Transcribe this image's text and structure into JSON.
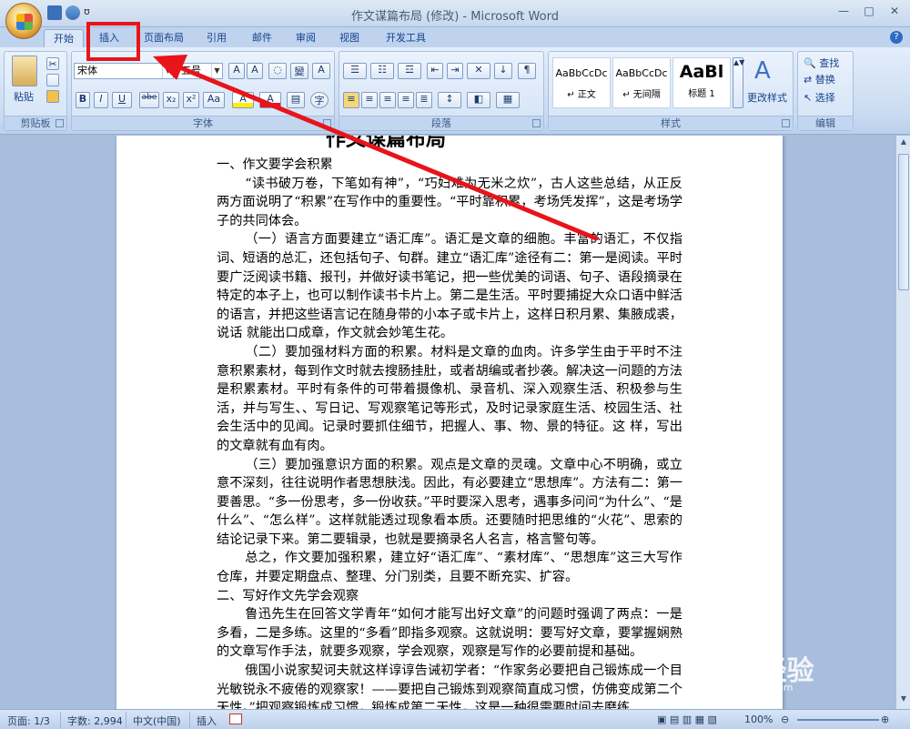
{
  "window": {
    "title": "作文谋篇布局 (修改) - Microsoft Word",
    "redo_glyph": "ʊ",
    "controls": [
      "—",
      "□",
      "✕"
    ]
  },
  "tabs": [
    {
      "label": "开始",
      "active": true
    },
    {
      "label": "插入",
      "active": false
    },
    {
      "label": "页面布局",
      "active": false
    },
    {
      "label": "引用",
      "active": false
    },
    {
      "label": "邮件",
      "active": false
    },
    {
      "label": "审阅",
      "active": false
    },
    {
      "label": "视图",
      "active": false
    },
    {
      "label": "开发工具",
      "active": false
    }
  ],
  "ribbon": {
    "clipboard": {
      "label": "剪贴板",
      "paste": "粘贴"
    },
    "font": {
      "label": "字体",
      "font_name": "宋体",
      "font_size": "五号",
      "buttons": [
        "B",
        "I",
        "U",
        "abe",
        "x₂",
        "x²",
        "Aa",
        "A",
        "A"
      ]
    },
    "paragraph": {
      "label": "段落"
    },
    "styles": {
      "label": "样式",
      "items": [
        {
          "sample": "AaBbCcDc",
          "name": "↵ 正文"
        },
        {
          "sample": "AaBbCcDc",
          "name": "↵ 无间隔"
        },
        {
          "sample": "AaBl",
          "name": "标题 1"
        }
      ],
      "change_styles": "更改样式"
    },
    "editing": {
      "label": "编辑",
      "find": "查找",
      "replace": "替换",
      "select": "选择"
    }
  },
  "document": {
    "title": "作文谋篇布局",
    "paragraphs": [
      {
        "text": "一、作文要学会积累",
        "indent": false
      },
      {
        "text": "“读书破万卷，下笔如有神”，“巧妇难为无米之炊”，古人这些总结，从正反两方面说明了“积累”在写作中的重要性。“平时靠积累，考场凭发挥”，这是考场学子的共同体会。",
        "indent": true
      },
      {
        "text": "（一）语言方面要建立“语汇库”。语汇是文章的细胞。丰富的语汇，不仅指词、短语的总汇，还包括句子、句群。建立“语汇库”途径有二：第一是阅读。平时要广泛阅读书籍、报刊，并做好读书笔记，把一些优美的词语、句子、语段摘录在特定的本子上，也可以制作读书卡片上。第二是生活。平时要捕捉大众口语中鲜活的语言，并把这些语言记在随身带的小本子或卡片上，这样日积月累、集腋成裘，说话 就能出口成章，作文就会妙笔生花。",
        "indent": true
      },
      {
        "text": "（二）要加强材料方面的积累。材料是文章的血肉。许多学生由于平时不注意积累素材，每到作文时就去搜肠挂肚，或者胡编或者抄袭。解决这一问题的方法是积累素材。平时有条件的可带着摄像机、录音机、深入观察生活、积极参与生活，并与写生、、写日记、写观察笔记等形式，及时记录家庭生活、校园生活、社会生活中的见闻。记录时要抓住细节，把握人、事、物、景的特征。这 样，写出的文章就有血有肉。",
        "indent": true
      },
      {
        "text": "（三）要加强意识方面的积累。观点是文章的灵魂。文章中心不明确，或立意不深刻，往往说明作者思想肤浅。因此，有必要建立“思想库”。方法有二：第一要善思。“多一份思考，多一份收获。”平时要深入思考，遇事多问问“为什么”、“是什么”、“怎么样”。这样就能透过现象看本质。还要随时把思维的“火花”、思索的结论记录下来。第二要辑录，也就是要摘录名人名言，格言警句等。",
        "indent": true
      },
      {
        "text": "总之，作文要加强积累，建立好“语汇库”、“素材库”、“思想库”这三大写作仓库，并要定期盘点、整理、分门别类，且要不断充实、扩容。",
        "indent": true
      },
      {
        "text": "二、写好作文先学会观察",
        "indent": false
      },
      {
        "text": "鲁迅先生在回答文学青年“如何才能写出好文章”的问题时强调了两点：一是多看，二是多练。这里的“多看”即指多观察。这就说明：要写好文章，要掌握娴熟的文章写作手法，就要多观察，学会观察，观察是写作的必要前提和基础。",
        "indent": true
      },
      {
        "text": "俄国小说家契诃夫就这样谆谆告诫初学者：“作家务必要把自己锻炼成一个目光敏锐永不疲倦的观察家！——要把自己锻炼到观察简直成习惯，仿佛变成第二个天性。”把观察锻炼成习惯，锻炼成第二天性，这是一种很需要时间去磨练",
        "indent": true
      }
    ]
  },
  "statusbar": {
    "page": "页面: 1/3",
    "words": "字数: 2,994",
    "language": "中文(中国)",
    "mode": "插入",
    "zoom": "100%"
  },
  "watermark": {
    "brand": "Bai❀经验",
    "url": "jingyan.baidu.com"
  },
  "colors": {
    "annotation": "#e8141a",
    "ribbon": "#dbe7f6"
  }
}
